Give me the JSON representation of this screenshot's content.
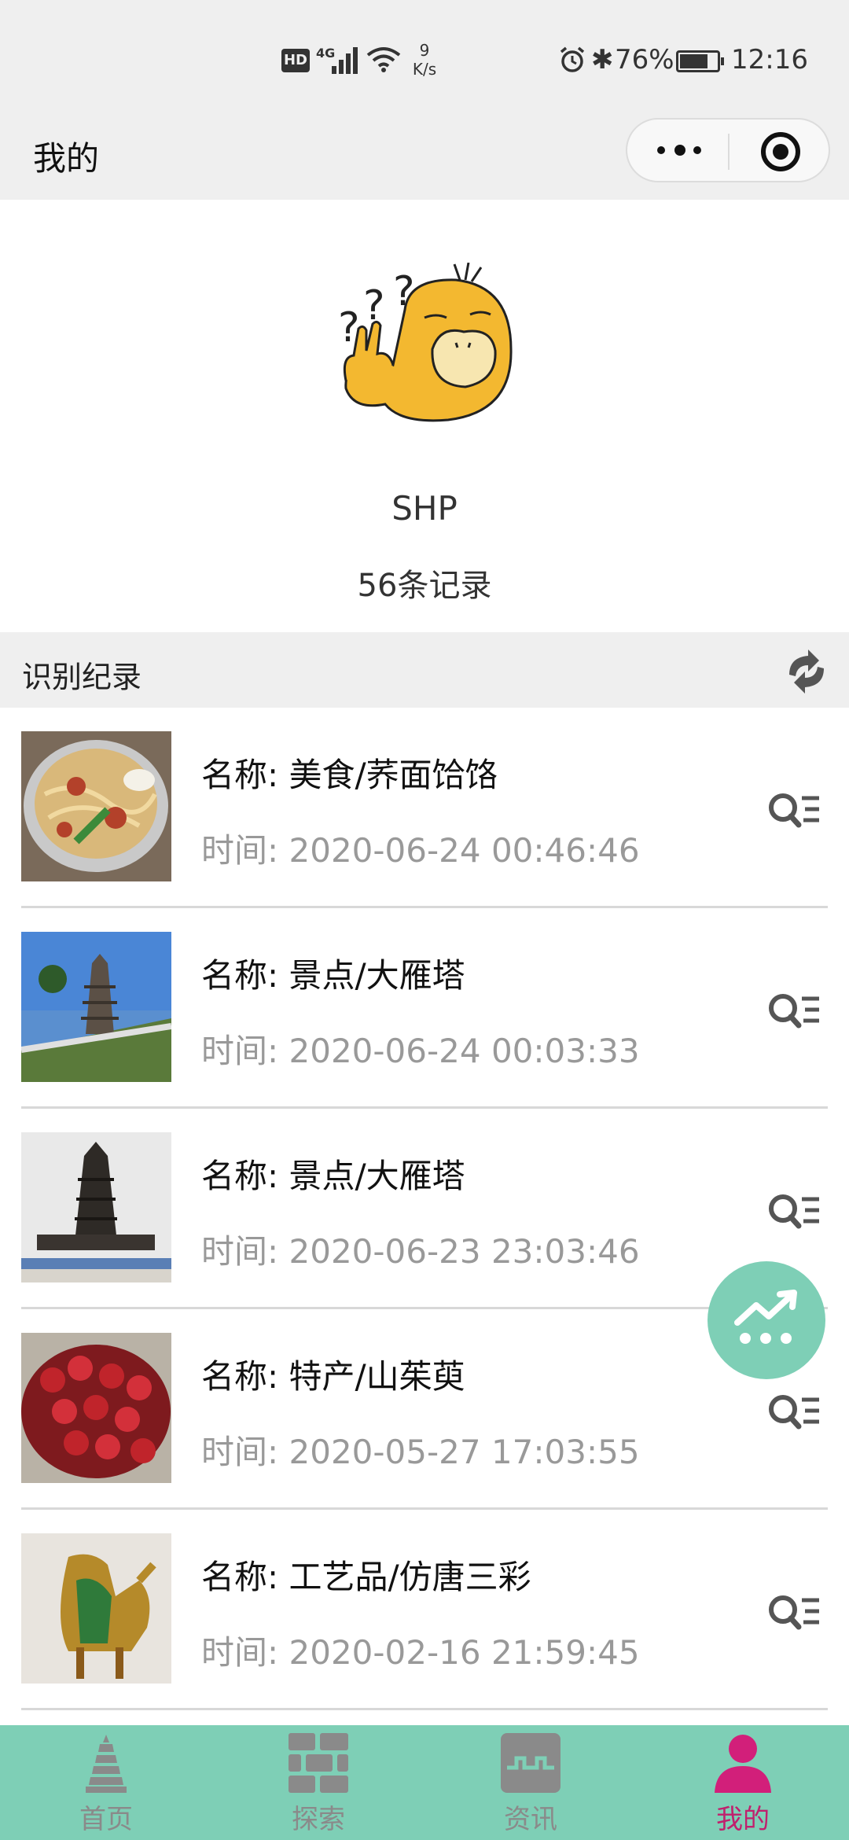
{
  "status_bar": {
    "hd": "HD",
    "network": "4G",
    "speed_value": "9",
    "speed_unit": "K/s",
    "battery": "76%",
    "time": "12:16"
  },
  "navbar": {
    "title": "我的"
  },
  "profile": {
    "username": "SHP",
    "record_count": "56条记录"
  },
  "section": {
    "title": "识别纪录"
  },
  "records": [
    {
      "name_label": "名称:",
      "name": "美食/荞面饸饹",
      "time_label": "时间:",
      "time": "2020-06-24 00:46:46"
    },
    {
      "name_label": "名称:",
      "name": "景点/大雁塔",
      "time_label": "时间:",
      "time": "2020-06-24 00:03:33"
    },
    {
      "name_label": "名称:",
      "name": "景点/大雁塔",
      "time_label": "时间:",
      "time": "2020-06-23 23:03:46"
    },
    {
      "name_label": "名称:",
      "name": "特产/山茱萸",
      "time_label": "时间:",
      "time": "2020-05-27 17:03:55"
    },
    {
      "name_label": "名称:",
      "name": "工艺品/仿唐三彩",
      "time_label": "时间:",
      "time": "2020-02-16 21:59:45"
    }
  ],
  "tabs": [
    {
      "label": "首页",
      "icon": "pagoda-icon"
    },
    {
      "label": "探索",
      "icon": "bricks-icon"
    },
    {
      "label": "资讯",
      "icon": "gate-icon"
    },
    {
      "label": "我的",
      "icon": "user-icon",
      "active": true
    }
  ],
  "colors": {
    "accent": "#7ecfb6",
    "active_tab": "#c0206d",
    "header_bg": "#efefef"
  }
}
